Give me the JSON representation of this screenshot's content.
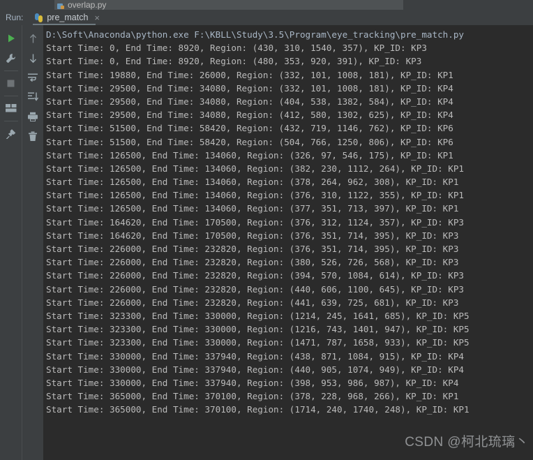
{
  "editor": {
    "tab_label": "overlap.py",
    "tab_icon": "python-file-icon"
  },
  "run_panel": {
    "label": "Run:",
    "tab_name": "pre_match",
    "tab_icon": "python-icon",
    "close_icon": "×"
  },
  "toolbar_left": [
    {
      "name": "rerun-button",
      "icon": "play-icon"
    },
    {
      "name": "edit-configurations-button",
      "icon": "wrench-icon"
    },
    {
      "name": "stop-button",
      "icon": "stop-icon"
    },
    {
      "name": "layout-button",
      "icon": "layout-icon"
    },
    {
      "name": "pin-tab-button",
      "icon": "pin-icon"
    }
  ],
  "toolbar_right": [
    {
      "name": "previous-occurrence-button",
      "icon": "arrow-up-icon"
    },
    {
      "name": "next-occurrence-button",
      "icon": "arrow-down-icon"
    },
    {
      "name": "soft-wrap-button",
      "icon": "soft-wrap-icon"
    },
    {
      "name": "scroll-to-end-button",
      "icon": "scroll-to-end-icon"
    },
    {
      "name": "print-button",
      "icon": "printer-icon"
    },
    {
      "name": "clear-all-button",
      "icon": "trash-icon"
    }
  ],
  "console": {
    "command_line": "D:\\Soft\\Anaconda\\python.exe F:\\KBLL\\Study\\3.5\\Program\\eye_tracking\\pre_match.py",
    "lines": [
      "Start Time: 0, End Time: 8920, Region: (430, 310, 1540, 357), KP_ID: KP3",
      "Start Time: 0, End Time: 8920, Region: (480, 353, 920, 391), KP_ID: KP3",
      "Start Time: 19880, End Time: 26000, Region: (332, 101, 1008, 181), KP_ID: KP1",
      "Start Time: 29500, End Time: 34080, Region: (332, 101, 1008, 181), KP_ID: KP4",
      "Start Time: 29500, End Time: 34080, Region: (404, 538, 1382, 584), KP_ID: KP4",
      "Start Time: 29500, End Time: 34080, Region: (412, 580, 1302, 625), KP_ID: KP4",
      "Start Time: 51500, End Time: 58420, Region: (432, 719, 1146, 762), KP_ID: KP6",
      "Start Time: 51500, End Time: 58420, Region: (504, 766, 1250, 806), KP_ID: KP6",
      "Start Time: 126500, End Time: 134060, Region: (326, 97, 546, 175), KP_ID: KP1",
      "Start Time: 126500, End Time: 134060, Region: (382, 230, 1112, 264), KP_ID: KP1",
      "Start Time: 126500, End Time: 134060, Region: (378, 264, 962, 308), KP_ID: KP1",
      "Start Time: 126500, End Time: 134060, Region: (376, 310, 1122, 355), KP_ID: KP1",
      "Start Time: 126500, End Time: 134060, Region: (377, 351, 713, 397), KP_ID: KP1",
      "Start Time: 164620, End Time: 170500, Region: (376, 312, 1124, 357), KP_ID: KP3",
      "Start Time: 164620, End Time: 170500, Region: (376, 351, 714, 395), KP_ID: KP3",
      "Start Time: 226000, End Time: 232820, Region: (376, 351, 714, 395), KP_ID: KP3",
      "Start Time: 226000, End Time: 232820, Region: (380, 526, 726, 568), KP_ID: KP3",
      "Start Time: 226000, End Time: 232820, Region: (394, 570, 1084, 614), KP_ID: KP3",
      "Start Time: 226000, End Time: 232820, Region: (440, 606, 1100, 645), KP_ID: KP3",
      "Start Time: 226000, End Time: 232820, Region: (441, 639, 725, 681), KP_ID: KP3",
      "Start Time: 323300, End Time: 330000, Region: (1214, 245, 1641, 685), KP_ID: KP5",
      "Start Time: 323300, End Time: 330000, Region: (1216, 743, 1401, 947), KP_ID: KP5",
      "Start Time: 323300, End Time: 330000, Region: (1471, 787, 1658, 933), KP_ID: KP5",
      "Start Time: 330000, End Time: 337940, Region: (438, 871, 1084, 915), KP_ID: KP4",
      "Start Time: 330000, End Time: 337940, Region: (440, 905, 1074, 949), KP_ID: KP4",
      "Start Time: 330000, End Time: 337940, Region: (398, 953, 986, 987), KP_ID: KP4",
      "Start Time: 365000, End Time: 370100, Region: (378, 228, 968, 266), KP_ID: KP1",
      "Start Time: 365000, End Time: 370100, Region: (1714, 240, 1740, 248), KP_ID: KP1"
    ]
  },
  "watermark": "CSDN @柯北琉璃丶",
  "colors": {
    "console_bg": "#2b2b2b",
    "panel_bg": "#3c3f41",
    "output_text": "#bbbbbb",
    "command_text": "#a9b7c6",
    "accent_green": "#4caf50",
    "tab_active_bg": "#4e5254"
  }
}
